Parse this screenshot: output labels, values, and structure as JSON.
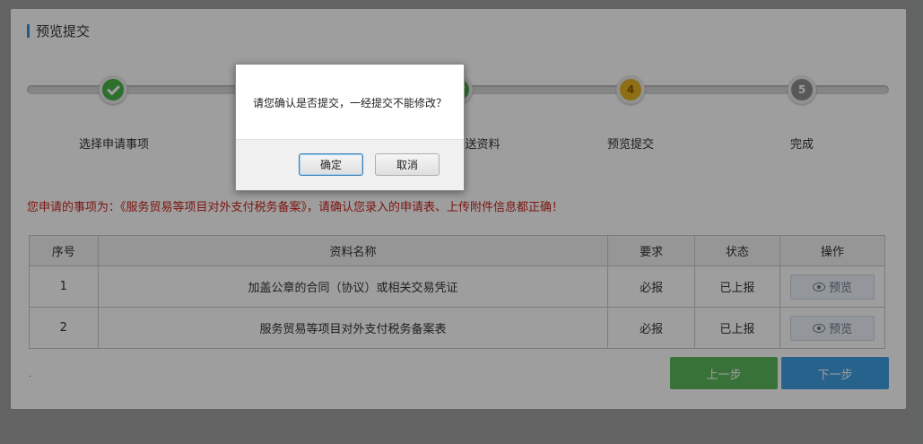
{
  "page": {
    "section_title": "预览提交"
  },
  "steps": [
    {
      "label": "选择申请事项",
      "number": "",
      "state": "done"
    },
    {
      "label": "",
      "number": "",
      "state": "done"
    },
    {
      "label": "送资料",
      "number": "",
      "state": "done"
    },
    {
      "label": "预览提交",
      "number": "4",
      "state": "current"
    },
    {
      "label": "完成",
      "number": "5",
      "state": "todo"
    }
  ],
  "notice": "您申请的事项为：《服务贸易等项目对外支付税务备案》，请确认您录入的申请表、上传附件信息都正确！",
  "table": {
    "headers": [
      "序号",
      "资料名称",
      "要求",
      "状态",
      "操作"
    ],
    "rows": [
      {
        "index": "1",
        "name": "加盖公章的合同（协议）或相关交易凭证",
        "requirement": "必报",
        "status": "已上报",
        "action": "预览"
      },
      {
        "index": "2",
        "name": "服务贸易等项目对外支付税务备案表",
        "requirement": "必报",
        "status": "已上报",
        "action": "预览"
      }
    ]
  },
  "buttons": {
    "prev": "上一步",
    "next": "下一步"
  },
  "footer_dot": ".",
  "dialog": {
    "message": "请您确认是否提交，一经提交不能修改？",
    "ok": "确定",
    "cancel": "取消"
  },
  "colors": {
    "done": "#4bb34b",
    "current": "#e5b325",
    "todo": "#8e8e8e",
    "notice": "#c9241c",
    "prev_button": "#5cb85c",
    "next_button": "#3f9fe4"
  },
  "icons": {
    "step_done": "check-icon",
    "preview": "eye-icon"
  }
}
